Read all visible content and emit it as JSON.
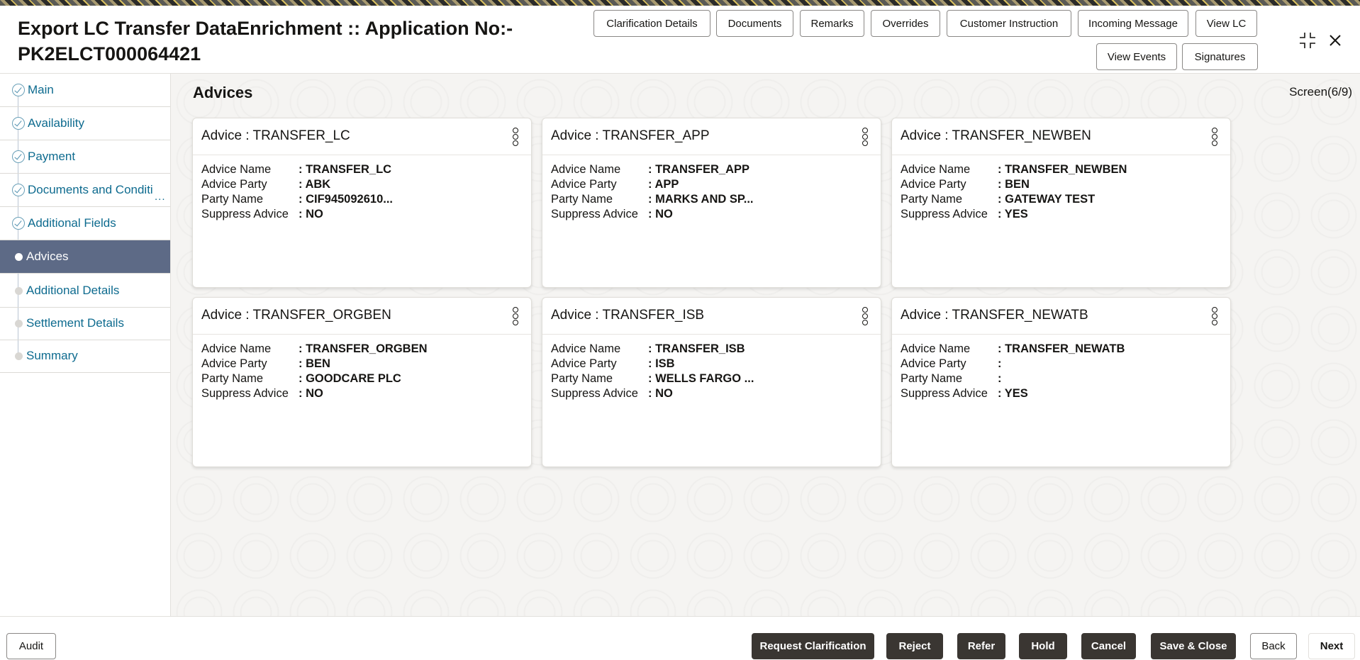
{
  "header": {
    "title": "Export LC Transfer DataEnrichment :: Application No:- PK2ELCT000064421",
    "buttons": [
      "Clarification Details",
      "Documents",
      "Remarks",
      "Overrides",
      "Customer Instruction",
      "Incoming Message",
      "View LC",
      "View Events",
      "Signatures"
    ],
    "icons": [
      "collapse-icon",
      "close-icon"
    ]
  },
  "sidebar": {
    "items": [
      {
        "label": "Main",
        "state": "done"
      },
      {
        "label": "Availability",
        "state": "done"
      },
      {
        "label": "Payment",
        "state": "done"
      },
      {
        "label": "Documents and Conditi",
        "state": "done"
      },
      {
        "label": "Additional Fields",
        "state": "done"
      },
      {
        "label": "Advices",
        "state": "active"
      },
      {
        "label": "Additional Details",
        "state": "pending"
      },
      {
        "label": "Settlement Details",
        "state": "pending"
      },
      {
        "label": "Summary",
        "state": "pending"
      }
    ],
    "more": "..."
  },
  "main": {
    "title": "Advices",
    "screen": "Screen(6/9)",
    "labels": {
      "name": "Advice Name",
      "party": "Advice Party",
      "party_name": "Party Name",
      "suppress": "Suppress Advice"
    },
    "cards": [
      {
        "title": "Advice : TRANSFER_LC",
        "name": ": TRANSFER_LC",
        "party": ": ABK",
        "party_name": ": CIF945092610...",
        "suppress": ": NO"
      },
      {
        "title": "Advice : TRANSFER_APP",
        "name": ": TRANSFER_APP",
        "party": ": APP",
        "party_name": ": MARKS AND SP...",
        "suppress": ": NO"
      },
      {
        "title": "Advice : TRANSFER_NEWBEN",
        "name": ": TRANSFER_NEWBEN",
        "party": ": BEN",
        "party_name": ": GATEWAY TEST",
        "suppress": ": YES"
      },
      {
        "title": "Advice : TRANSFER_ORGBEN",
        "name": ": TRANSFER_ORGBEN",
        "party": ": BEN",
        "party_name": ": GOODCARE PLC",
        "suppress": ": NO"
      },
      {
        "title": "Advice : TRANSFER_ISB",
        "name": ": TRANSFER_ISB",
        "party": ": ISB",
        "party_name": ": WELLS FARGO ...",
        "suppress": ": NO"
      },
      {
        "title": "Advice : TRANSFER_NEWATB",
        "name": ": TRANSFER_NEWATB",
        "party": ":",
        "party_name": ":",
        "suppress": ": YES"
      }
    ]
  },
  "footer": {
    "audit": "Audit",
    "buttons": [
      "Request Clarification",
      "Reject",
      "Refer",
      "Hold",
      "Cancel",
      "Save & Close",
      "Back",
      "Next"
    ]
  }
}
